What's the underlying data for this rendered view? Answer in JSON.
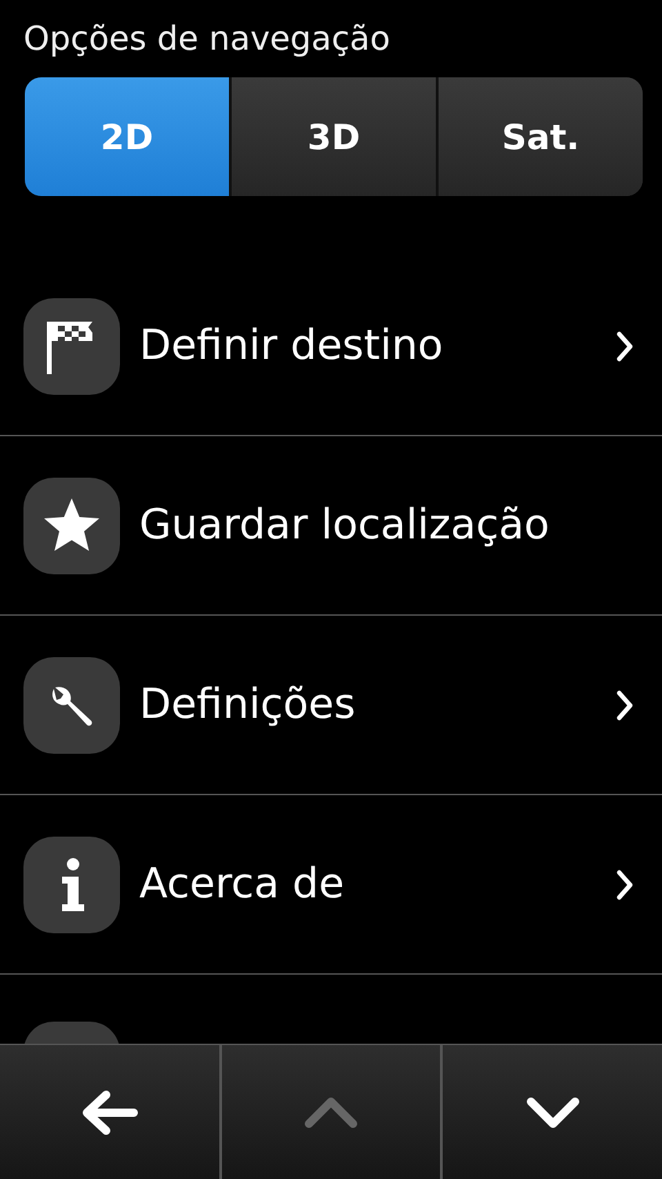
{
  "title": "Opções de navegação",
  "view_modes": [
    {
      "label": "2D",
      "selected": true
    },
    {
      "label": "3D",
      "selected": false
    },
    {
      "label": "Sat.",
      "selected": false
    }
  ],
  "menu_items": [
    {
      "label": "Definir destino",
      "has_submenu": true
    },
    {
      "label": "Guardar localização",
      "has_submenu": false
    },
    {
      "label": "Definições",
      "has_submenu": true
    },
    {
      "label": "Acerca de",
      "has_submenu": true
    },
    {
      "kind": "partial"
    }
  ],
  "toolbar": [
    {
      "kind": "back",
      "disabled": false
    },
    {
      "kind": "up",
      "disabled": true
    },
    {
      "kind": "down",
      "disabled": false
    }
  ]
}
